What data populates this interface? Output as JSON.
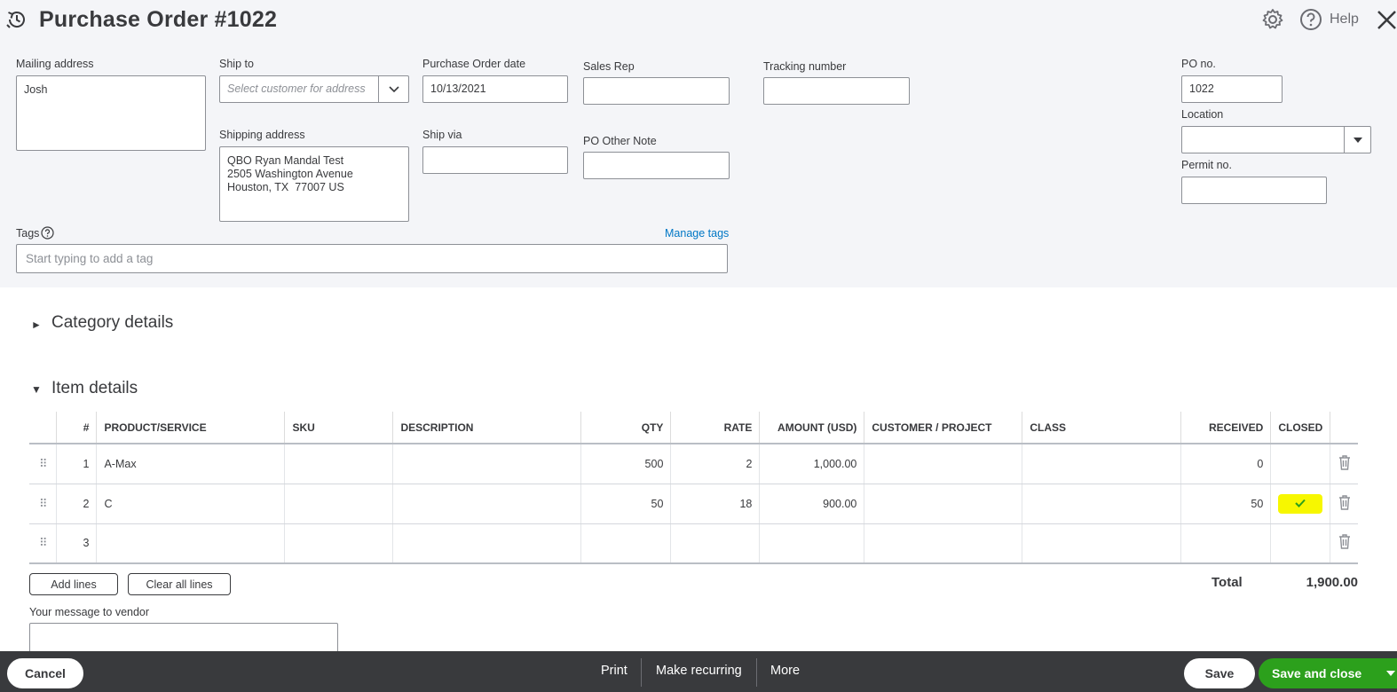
{
  "header": {
    "title": "Purchase Order #1022",
    "help_label": "Help"
  },
  "form": {
    "mailing_address": {
      "label": "Mailing address",
      "value": "Josh"
    },
    "ship_to": {
      "label": "Ship to",
      "placeholder": "Select customer for address"
    },
    "po_date": {
      "label": "Purchase Order date",
      "value": "10/13/2021"
    },
    "sales_rep": {
      "label": "Sales Rep",
      "value": ""
    },
    "tracking_number": {
      "label": "Tracking number",
      "value": ""
    },
    "shipping_address": {
      "label": "Shipping address",
      "line1": "QBO Ryan Mandal Test",
      "line2": "2505 Washington Avenue",
      "line3": "Houston, TX  77007 US"
    },
    "ship_via": {
      "label": "Ship via",
      "value": ""
    },
    "po_other_note": {
      "label": "PO Other Note",
      "value": ""
    },
    "po_no": {
      "label": "PO no.",
      "value": "1022"
    },
    "location": {
      "label": "Location",
      "value": ""
    },
    "permit_no": {
      "label": "Permit no.",
      "value": ""
    },
    "tags": {
      "label": "Tags",
      "placeholder": "Start typing to add a tag",
      "manage_link": "Manage tags"
    }
  },
  "sections": {
    "category_details": "Category details",
    "item_details": "Item details"
  },
  "table": {
    "headers": {
      "num": "#",
      "product": "PRODUCT/SERVICE",
      "sku": "SKU",
      "description": "DESCRIPTION",
      "qty": "QTY",
      "rate": "RATE",
      "amount": "AMOUNT (USD)",
      "customer": "CUSTOMER / PROJECT",
      "class": "CLASS",
      "received": "RECEIVED",
      "closed": "CLOSED"
    },
    "rows": [
      {
        "num": "1",
        "product": "A-Max",
        "sku": "",
        "description": "",
        "qty": "500",
        "rate": "2",
        "amount": "1,000.00",
        "customer": "",
        "class": "",
        "received": "0",
        "closed": false
      },
      {
        "num": "2",
        "product": "C",
        "sku": "",
        "description": "",
        "qty": "50",
        "rate": "18",
        "amount": "900.00",
        "customer": "",
        "class": "",
        "received": "50",
        "closed": true
      },
      {
        "num": "3",
        "product": "",
        "sku": "",
        "description": "",
        "qty": "",
        "rate": "",
        "amount": "",
        "customer": "",
        "class": "",
        "received": "",
        "closed": false
      }
    ],
    "add_lines": "Add lines",
    "clear_lines": "Clear all lines",
    "total_label": "Total",
    "total_value": "1,900.00"
  },
  "message": {
    "label": "Your message to vendor",
    "value": ""
  },
  "footer": {
    "cancel": "Cancel",
    "print": "Print",
    "make_recurring": "Make recurring",
    "more": "More",
    "save": "Save",
    "save_and_close": "Save and close"
  },
  "colors": {
    "accent_green": "#2ca01c",
    "link_blue": "#0077c5",
    "highlight_yellow": "#f7f700",
    "footer_bg": "#393a3d"
  }
}
